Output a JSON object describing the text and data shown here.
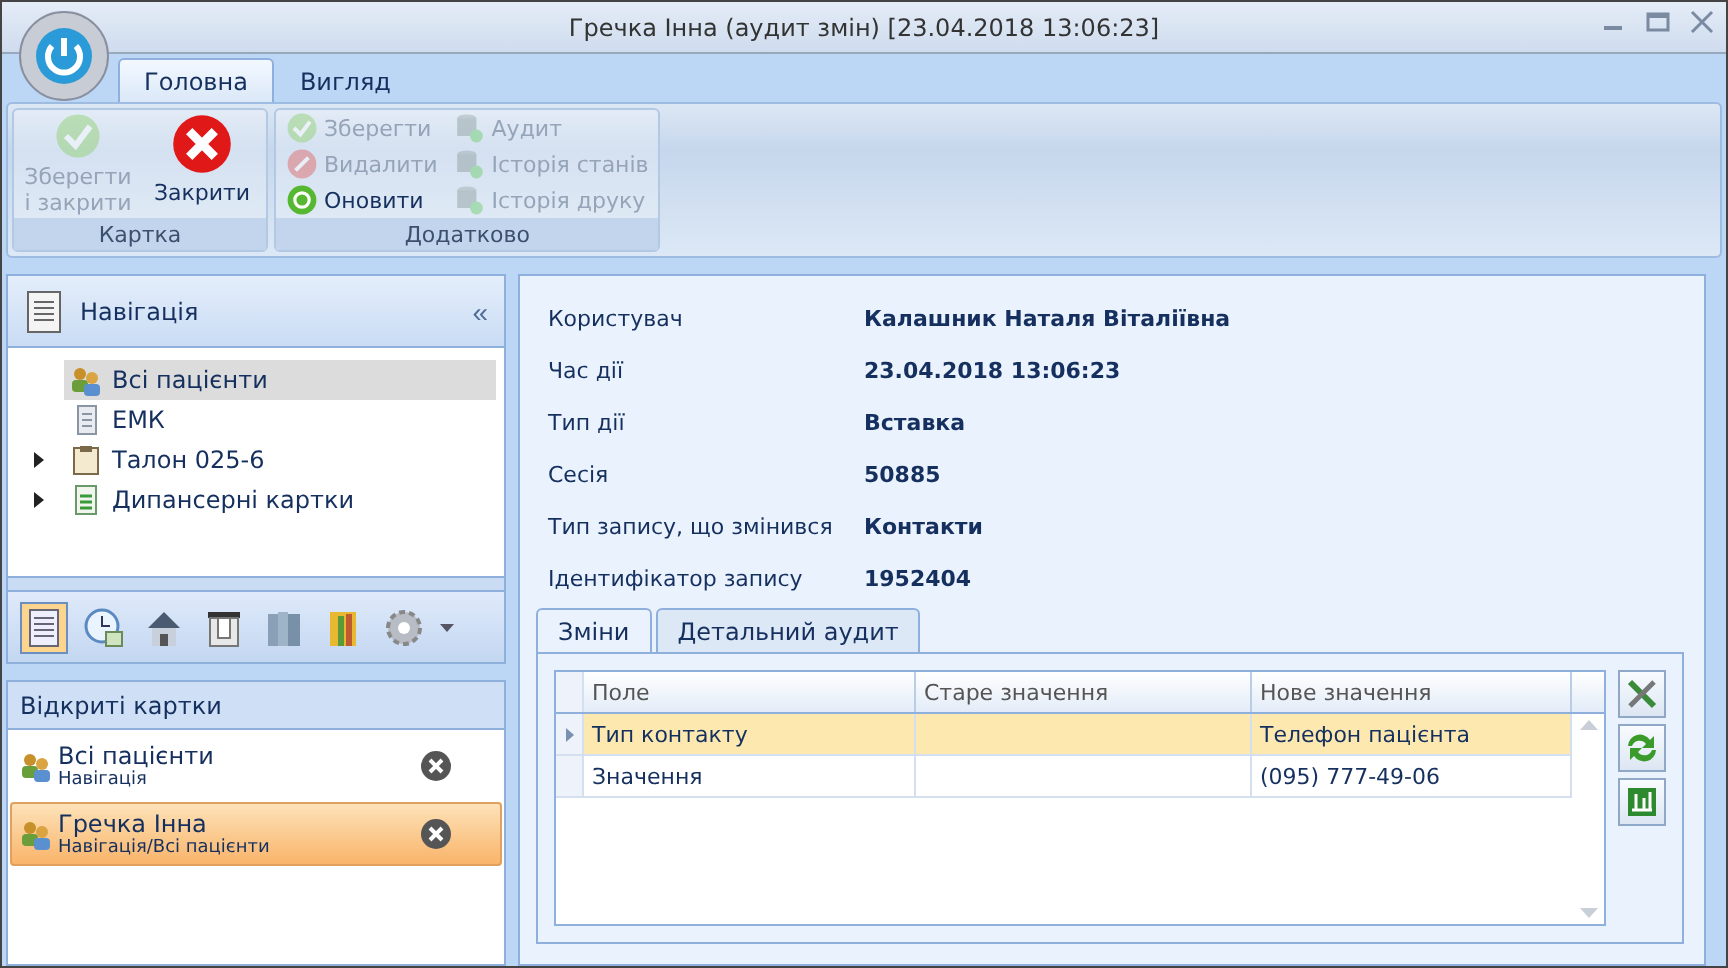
{
  "window": {
    "title": "Гречка Інна (аудит змін) [23.04.2018 13:06:23]"
  },
  "ribbon_tabs": [
    {
      "label": "Головна",
      "selected": true
    },
    {
      "label": "Вигляд",
      "selected": false
    }
  ],
  "ribbon_groups": [
    {
      "label": "Картка",
      "large_buttons": [
        {
          "label": "Зберегти і закрити",
          "kind": "check",
          "disabled": true
        },
        {
          "label": "Закрити",
          "kind": "close",
          "disabled": false
        }
      ]
    },
    {
      "label": "Додатково",
      "columns": [
        [
          {
            "label": "Зберегти",
            "kind": "check",
            "disabled": true
          },
          {
            "label": "Видалити",
            "kind": "delete",
            "disabled": true
          },
          {
            "label": "Оновити",
            "kind": "refresh",
            "disabled": false
          }
        ],
        [
          {
            "label": "Аудит",
            "kind": "db",
            "disabled": true
          },
          {
            "label": "Історія станів",
            "kind": "db",
            "disabled": true
          },
          {
            "label": "Історія друку",
            "kind": "db",
            "disabled": true
          }
        ]
      ]
    }
  ],
  "navigation": {
    "title": "Навігація",
    "collapse": "«",
    "tree": [
      {
        "label": "Всі пацієнти",
        "kind": "people",
        "selected": true
      },
      {
        "label": "ЕМК",
        "kind": "doc",
        "selected": false
      },
      {
        "label": "Талон 025-6",
        "kind": "clipboard",
        "selected": false,
        "expanded": false
      },
      {
        "label": "Дипансерні картки",
        "kind": "sheet",
        "selected": false,
        "expanded": false
      }
    ],
    "toolbar": [
      {
        "kind": "list",
        "selected": true
      },
      {
        "kind": "clock",
        "selected": false
      },
      {
        "kind": "house",
        "selected": false
      },
      {
        "kind": "printer",
        "selected": false
      },
      {
        "kind": "books",
        "selected": false
      },
      {
        "kind": "folder",
        "selected": false
      },
      {
        "kind": "gear",
        "selected": false
      }
    ]
  },
  "open_cards": {
    "title": "Відкриті картки",
    "items": [
      {
        "name": "Всі пацієнти",
        "path": "Навігація",
        "selected": false
      },
      {
        "name": "Гречка Інна",
        "path": "Навігація/Всі пацієнти",
        "selected": true
      }
    ]
  },
  "details": [
    {
      "label": "Користувач",
      "value": "Калашник Наталя Віталіївна"
    },
    {
      "label": "Час дії",
      "value": "23.04.2018 13:06:23"
    },
    {
      "label": "Тип дії",
      "value": "Вставка"
    },
    {
      "label": "Сесія",
      "value": "50885"
    },
    {
      "label": "Тип запису, що змінився",
      "value": "Контакти"
    },
    {
      "label": "Ідентифікатор запису",
      "value": "1952404"
    }
  ],
  "content_tabs": [
    {
      "label": "Зміни",
      "selected": true
    },
    {
      "label": "Детальний аудит",
      "selected": false
    }
  ],
  "table": {
    "columns": [
      "Поле",
      "Старе значення",
      "Нове значення"
    ],
    "rows": [
      {
        "cells": [
          "Тип контакту",
          "",
          "Телефон пацієнта"
        ],
        "selected": true
      },
      {
        "cells": [
          "Значення",
          "",
          "(095) 777-49-06"
        ],
        "selected": false
      }
    ]
  },
  "side_buttons": [
    {
      "kind": "tools"
    },
    {
      "kind": "arrows"
    },
    {
      "kind": "chart"
    }
  ]
}
